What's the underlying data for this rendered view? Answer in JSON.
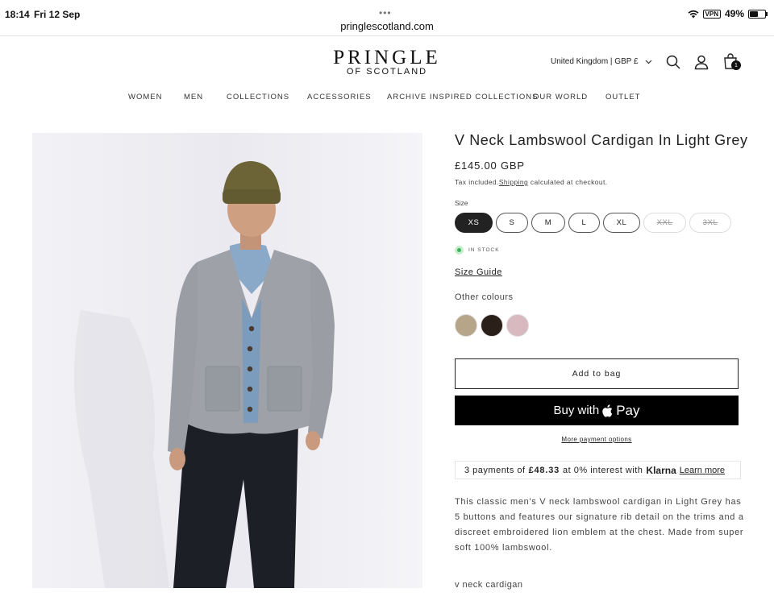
{
  "status_bar": {
    "time": "18:14",
    "date": "Fri 12 Sep",
    "url": "pringlescotland.com",
    "vpn": "VPN",
    "battery": "49%",
    "battery_level": 0.49
  },
  "header": {
    "logo_main": "PRINGLE",
    "logo_sub": "OF SCOTLAND",
    "region": "United Kingdom | GBP £",
    "cart_count": "1",
    "nav": [
      "WOMEN",
      "MEN",
      "COLLECTIONS",
      "ACCESSORIES",
      "ARCHIVE INSPIRED COLLECTIONS",
      "OUR WORLD",
      "OUTLET"
    ]
  },
  "product": {
    "title": "V Neck Lambswool Cardigan In Light Grey",
    "price": "£145.00 GBP",
    "tax_prefix": "Tax included.",
    "tax_link": "Shipping",
    "tax_suffix": " calculated at checkout.",
    "size_label": "Size",
    "sizes": [
      {
        "label": "XS",
        "state": "selected"
      },
      {
        "label": "S",
        "state": "available"
      },
      {
        "label": "M",
        "state": "available"
      },
      {
        "label": "L",
        "state": "available"
      },
      {
        "label": "XL",
        "state": "available"
      },
      {
        "label": "XXL",
        "state": "unavailable"
      },
      {
        "label": "3XL",
        "state": "unavailable"
      }
    ],
    "stock": "IN STOCK",
    "size_guide": "Size Guide",
    "other_colours_label": "Other colours",
    "colour_swatches": [
      "#b7a58a",
      "#2b2019",
      "#d9b9c0"
    ],
    "add_to_bag": "Add to bag",
    "buy_with": "Buy with",
    "apple_pay": "Pay",
    "more_payment": "More payment options",
    "klarna": {
      "prefix": "3 payments of",
      "amount": "£48.33",
      "middle": "at 0% interest with",
      "brand": "Klarna",
      "link": "Learn more"
    },
    "description": "This classic men's V neck lambswool cardigan in Light Grey has 5 buttons and features our signature rib detail on the trims and a discreet embroidered lion emblem at the chest. Made from super soft 100% lambswool.",
    "tagline": "v neck cardigan"
  },
  "colors": {
    "accent": "#222222",
    "stock_green": "#3fb25a"
  }
}
